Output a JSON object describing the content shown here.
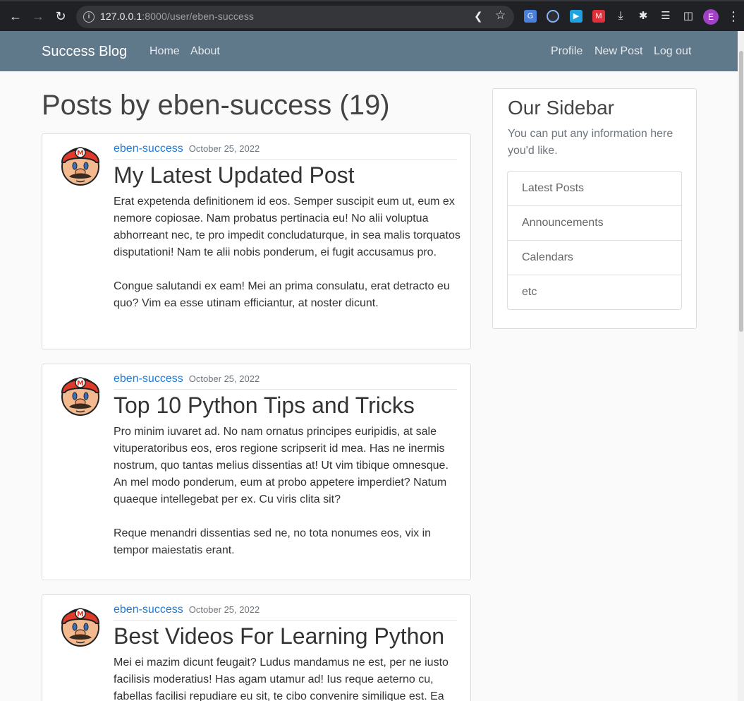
{
  "browser": {
    "url_host": "127.0.0.1",
    "url_path": ":8000/user/eben-success",
    "profile_initial": "E"
  },
  "navbar": {
    "brand": "Success Blog",
    "left_links": [
      "Home",
      "About"
    ],
    "right_links": [
      "Profile",
      "New Post",
      "Log out"
    ]
  },
  "page": {
    "title": "Posts by eben-success (19)"
  },
  "posts": [
    {
      "author": "eben-success",
      "date": "October 25, 2022",
      "title": "My Latest Updated Post",
      "paragraphs": [
        "Erat expetenda definitionem id eos. Semper suscipit eum ut, eum ex nemore copiosae. Nam probatus pertinacia eu! No alii voluptua abhorreant nec, te pro impedit concludaturque, in sea malis torquatos disputationi! Nam te alii nobis ponderum, ei fugit accusamus pro.",
        "Congue salutandi ex eam! Mei an prima consulatu, erat detracto eu quo? Vim ea esse utinam efficiantur, at noster dicunt."
      ]
    },
    {
      "author": "eben-success",
      "date": "October 25, 2022",
      "title": "Top 10 Python Tips and Tricks",
      "paragraphs": [
        "Pro minim iuvaret ad. No nam ornatus principes euripidis, at sale vituperatoribus eos, eros regione scripserit id mea. Has ne inermis nostrum, quo tantas melius dissentias at! Ut vim tibique omnesque. An mel modo ponderum, eum at probo appetere imperdiet? Natum quaeque intellegebat per ex. Cu viris clita sit?",
        "Reque menandri dissentias sed ne, no tota nonumes eos, vix in tempor maiestatis erant."
      ]
    },
    {
      "author": "eben-success",
      "date": "October 25, 2022",
      "title": "Best Videos For Learning Python",
      "paragraphs": [
        "Mei ei mazim dicunt feugait? Ludus mandamus ne est, per ne iusto facilisis moderatius! Has agam utamur ad! Ius reque aeterno cu, fabellas facilisi repudiare eu sit, te cibo convenire similique est. Ea"
      ]
    }
  ],
  "sidebar": {
    "title": "Our Sidebar",
    "description": "You can put any information here you'd like.",
    "items": [
      "Latest Posts",
      "Announcements",
      "Calendars",
      "etc"
    ]
  },
  "colors": {
    "navbar": "#5f788a",
    "link": "#1e7ad6"
  }
}
